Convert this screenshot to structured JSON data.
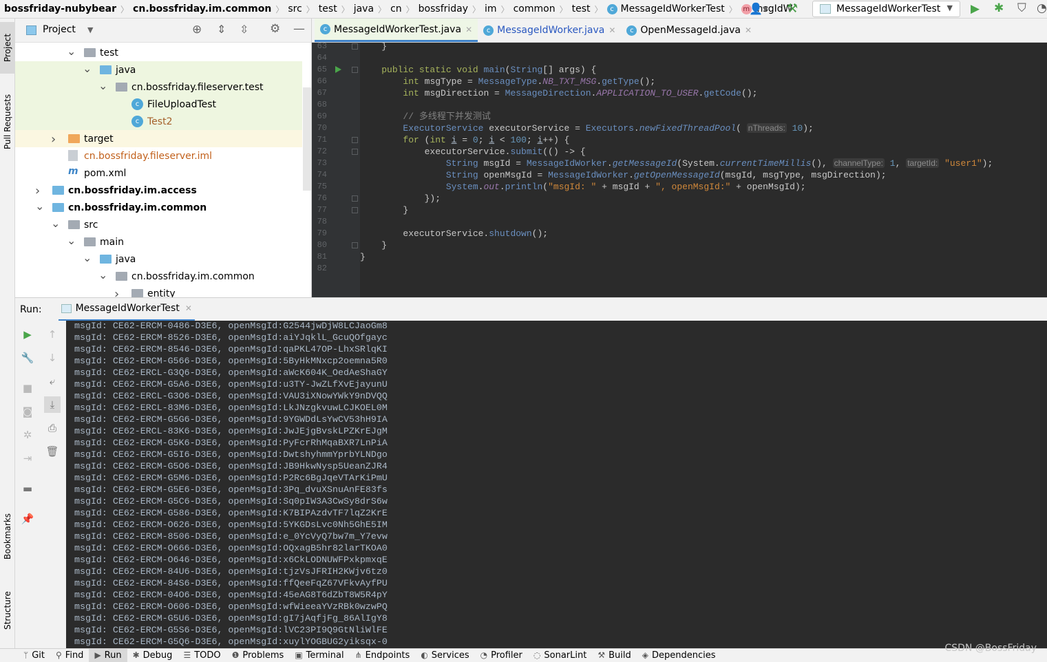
{
  "breadcrumb": [
    "bossfriday-nubybear",
    "cn.bossfriday.im.common",
    "src",
    "test",
    "java",
    "cn",
    "bossfriday",
    "im",
    "common",
    "test",
    "MessageIdWorkerTest",
    "msgIdW"
  ],
  "toolbar": {
    "run_config": "MessageIdWorkerTest"
  },
  "left_strip": {
    "project": "Project",
    "pull_requests": "Pull Requests",
    "bookmarks": "Bookmarks",
    "structure": "Structure"
  },
  "project_panel": {
    "title": "Project",
    "tree": [
      {
        "label": "test",
        "depth": 3,
        "icon": "folder",
        "expanded": true
      },
      {
        "label": "java",
        "depth": 4,
        "icon": "folder-test",
        "expanded": true,
        "highlight": "green"
      },
      {
        "label": "cn.bossfriday.fileserver.test",
        "depth": 5,
        "icon": "package",
        "expanded": true,
        "highlight": "green"
      },
      {
        "label": "FileUploadTest",
        "depth": 6,
        "icon": "class",
        "highlight": "green"
      },
      {
        "label": "Test2",
        "depth": 6,
        "icon": "class",
        "highlight": "green",
        "color": "#a5622c"
      },
      {
        "label": "target",
        "depth": 2,
        "icon": "folder-excluded",
        "expanded": false,
        "highlight": "yellow"
      },
      {
        "label": "cn.bossfriday.fileserver.iml",
        "depth": 2,
        "icon": "file",
        "color": "#c2611c"
      },
      {
        "label": "pom.xml",
        "depth": 2,
        "icon": "maven"
      },
      {
        "label": "cn.bossfriday.im.access",
        "depth": 1,
        "icon": "module",
        "expanded": false,
        "bold": true
      },
      {
        "label": "cn.bossfriday.im.common",
        "depth": 1,
        "icon": "module",
        "expanded": true,
        "bold": true
      },
      {
        "label": "src",
        "depth": 2,
        "icon": "folder",
        "expanded": true
      },
      {
        "label": "main",
        "depth": 3,
        "icon": "folder",
        "expanded": true
      },
      {
        "label": "java",
        "depth": 4,
        "icon": "folder-source",
        "expanded": true
      },
      {
        "label": "cn.bossfriday.im.common",
        "depth": 5,
        "icon": "package",
        "expanded": true
      },
      {
        "label": "entity",
        "depth": 6,
        "icon": "package",
        "expanded": false
      }
    ]
  },
  "editor": {
    "tabs": [
      {
        "label": "MessageIdWorkerTest.java",
        "active": true
      },
      {
        "label": "MessageIdWorker.java",
        "active": false
      },
      {
        "label": "OpenMessageId.java",
        "active": false
      }
    ],
    "lines": [
      {
        "n": "63",
        "fold": true,
        "t": [
          [
            "    }",
            "pl"
          ]
        ]
      },
      {
        "n": "64",
        "t": []
      },
      {
        "n": "65",
        "run": true,
        "fold": true,
        "t": [
          [
            "    ",
            "pl"
          ],
          [
            "public static void ",
            "kw"
          ],
          [
            "main",
            "mth"
          ],
          [
            "(",
            "pl"
          ],
          [
            "String",
            "ty"
          ],
          [
            "[] args) {",
            "pl"
          ]
        ]
      },
      {
        "n": "66",
        "t": [
          [
            "        ",
            "pl"
          ],
          [
            "int ",
            "kw"
          ],
          [
            "msgType = ",
            "pl"
          ],
          [
            "MessageType",
            "ty"
          ],
          [
            ".",
            "pl"
          ],
          [
            "NB_TXT_MSG",
            "cst"
          ],
          [
            ".",
            "pl"
          ],
          [
            "getType",
            "mth"
          ],
          [
            "();",
            "pl"
          ]
        ]
      },
      {
        "n": "67",
        "t": [
          [
            "        ",
            "pl"
          ],
          [
            "int ",
            "kw"
          ],
          [
            "msgDirection = ",
            "pl"
          ],
          [
            "MessageDirection",
            "ty"
          ],
          [
            ".",
            "pl"
          ],
          [
            "APPLICATION_TO_USER",
            "cst"
          ],
          [
            ".",
            "pl"
          ],
          [
            "getCode",
            "mth"
          ],
          [
            "();",
            "pl"
          ]
        ]
      },
      {
        "n": "68",
        "t": []
      },
      {
        "n": "69",
        "t": [
          [
            "        // 多线程下并发测试",
            "cm"
          ]
        ]
      },
      {
        "n": "70",
        "t": [
          [
            "        ",
            "pl"
          ],
          [
            "ExecutorService",
            "ty"
          ],
          [
            " executorService = ",
            "pl"
          ],
          [
            "Executors",
            "ty"
          ],
          [
            ".",
            "pl"
          ],
          [
            "newFixedThreadPool",
            "mi"
          ],
          [
            "( ",
            "pl"
          ],
          [
            "nThreads:",
            "hint"
          ],
          [
            " ",
            "pl"
          ],
          [
            "10",
            "num"
          ],
          [
            ");",
            "pl"
          ]
        ]
      },
      {
        "n": "71",
        "fold": true,
        "t": [
          [
            "        ",
            "pl"
          ],
          [
            "for ",
            "kw"
          ],
          [
            "(",
            "pl"
          ],
          [
            "int ",
            "kw"
          ],
          [
            "i",
            "ul"
          ],
          [
            " = ",
            "pl"
          ],
          [
            "0",
            "num"
          ],
          [
            "; ",
            "pl"
          ],
          [
            "i",
            "ul"
          ],
          [
            " < ",
            "pl"
          ],
          [
            "100",
            "num"
          ],
          [
            "; ",
            "pl"
          ],
          [
            "i",
            "ul"
          ],
          [
            "++) {",
            "pl"
          ]
        ]
      },
      {
        "n": "72",
        "fold": true,
        "t": [
          [
            "            executorService.",
            "pl"
          ],
          [
            "submit",
            "mth"
          ],
          [
            "(() -> {",
            "pl"
          ]
        ]
      },
      {
        "n": "73",
        "t": [
          [
            "                ",
            "pl"
          ],
          [
            "String",
            "ty"
          ],
          [
            " msgId = ",
            "pl"
          ],
          [
            "MessageIdWorker",
            "ty"
          ],
          [
            ".",
            "pl"
          ],
          [
            "getMessageId",
            "mi"
          ],
          [
            "(System.",
            "pl"
          ],
          [
            "currentTimeMillis",
            "mi"
          ],
          [
            "(), ",
            "pl"
          ],
          [
            "channelType:",
            "hint"
          ],
          [
            " ",
            "pl"
          ],
          [
            "1",
            "num"
          ],
          [
            ", ",
            "pl"
          ],
          [
            "targetId:",
            "hint"
          ],
          [
            " ",
            "pl"
          ],
          [
            "\"user1\"",
            "str"
          ],
          [
            ");",
            "pl"
          ]
        ]
      },
      {
        "n": "74",
        "t": [
          [
            "                ",
            "pl"
          ],
          [
            "String",
            "ty"
          ],
          [
            " openMsgId = ",
            "pl"
          ],
          [
            "MessageIdWorker",
            "ty"
          ],
          [
            ".",
            "pl"
          ],
          [
            "getOpenMessageId",
            "mi"
          ],
          [
            "(msgId, msgType, msgDirection);",
            "pl"
          ]
        ]
      },
      {
        "n": "75",
        "t": [
          [
            "                ",
            "pl"
          ],
          [
            "System",
            "ty"
          ],
          [
            ".",
            "pl"
          ],
          [
            "out",
            "fld"
          ],
          [
            ".",
            "pl"
          ],
          [
            "println",
            "mth"
          ],
          [
            "(",
            "pl"
          ],
          [
            "\"msgId: \"",
            "str"
          ],
          [
            " + msgId + ",
            "pl"
          ],
          [
            "\", openMsgId:\"",
            "str"
          ],
          [
            " + openMsgId);",
            "pl"
          ]
        ]
      },
      {
        "n": "76",
        "fold": true,
        "t": [
          [
            "            });",
            "pl"
          ]
        ]
      },
      {
        "n": "77",
        "fold": true,
        "t": [
          [
            "        }",
            "pl"
          ]
        ]
      },
      {
        "n": "78",
        "t": []
      },
      {
        "n": "79",
        "t": [
          [
            "        executorService.",
            "pl"
          ],
          [
            "shutdown",
            "mth"
          ],
          [
            "();",
            "pl"
          ]
        ]
      },
      {
        "n": "80",
        "fold": true,
        "t": [
          [
            "    }",
            "pl"
          ]
        ]
      },
      {
        "n": "81",
        "t": [
          [
            "}",
            "pl"
          ]
        ]
      },
      {
        "n": "82",
        "t": []
      }
    ]
  },
  "run_panel": {
    "label": "Run:",
    "tab": "MessageIdWorkerTest",
    "output": [
      "msgId: CE62-ERCM-0486-D3E6, openMsgId:G2544jwDjW8LCJaoGm8",
      "msgId: CE62-ERCM-8526-D3E6, openMsgId:aiYJqklL_GcuQOfgayc",
      "msgId: CE62-ERCM-8546-D3E6, openMsgId:qaPKL47OP-LhxSRlqKI",
      "msgId: CE62-ERCM-G566-D3E6, openMsgId:5ByHkMNxcp2oemna5R0",
      "msgId: CE62-ERCL-G3Q6-D3E6, openMsgId:aWcK604K_OedAeShaGY",
      "msgId: CE62-ERCM-G5A6-D3E6, openMsgId:u3TY-JwZLfXvEjayunU",
      "msgId: CE62-ERCL-G3O6-D3E6, openMsgId:VAU3iXNowYWkY9nDVQQ",
      "msgId: CE62-ERCL-83M6-D3E6, openMsgId:LkJNzgkvuwLCJKOEL0M",
      "msgId: CE62-ERCM-G5G6-D3E6, openMsgId:9YGWDdLsYwCV53hH9IA",
      "msgId: CE62-ERCL-83K6-D3E6, openMsgId:JwJEjgBvskLPZKrEJgM",
      "msgId: CE62-ERCM-G5K6-D3E6, openMsgId:PyFcrRhMqaBXR7LnPiA",
      "msgId: CE62-ERCM-G5I6-D3E6, openMsgId:DwtshyhmmYprbYLNDgo",
      "msgId: CE62-ERCM-G5O6-D3E6, openMsgId:JB9HkwNysp5UeanZJR4",
      "msgId: CE62-ERCM-G5M6-D3E6, openMsgId:P2Rc6BgJqeVTArKiPmU",
      "msgId: CE62-ERCM-G5E6-D3E6, openMsgId:3Pq_dvuXSnuAnFE83fs",
      "msgId: CE62-ERCM-G5C6-D3E6, openMsgId:Sq0pIW3A3CwSy8drS6w",
      "msgId: CE62-ERCM-G586-D3E6, openMsgId:K7BIPAzdvTF7lqZ2KrE",
      "msgId: CE62-ERCM-O626-D3E6, openMsgId:5YKGDsLvc0Nh5GhE5IM",
      "msgId: CE62-ERCM-8506-D3E6, openMsgId:e_0YcVyQ7bw7m_Y7evw",
      "msgId: CE62-ERCM-O666-D3E6, openMsgId:OQxagB5hr82larTKOA0",
      "msgId: CE62-ERCM-O646-D3E6, openMsgId:x6CkLODNUWFPxkpmxqE",
      "msgId: CE62-ERCM-84U6-D3E6, openMsgId:tjzVsJFRIH2KWjv6tz0",
      "msgId: CE62-ERCM-84S6-D3E6, openMsgId:ffQeeFqZ67VFkvAyfPU",
      "msgId: CE62-ERCM-04O6-D3E6, openMsgId:45eAG8T6dZbT8W5R4pY",
      "msgId: CE62-ERCM-O606-D3E6, openMsgId:wfWieeaYVzRBk0wzwPQ",
      "msgId: CE62-ERCM-G5U6-D3E6, openMsgId:gI7jAqfjFg_86AlIgY8",
      "msgId: CE62-ERCM-G5S6-D3E6, openMsgId:lVC23PI9Q9GtNliWlFE",
      "msgId: CE62-ERCM-G5Q6-D3E6, openMsgId:xuylYOGBUG2yiksqx-0"
    ]
  },
  "statusbar": [
    {
      "label": "Git",
      "icon": "git-branch-icon",
      "glyph": "ᛘ"
    },
    {
      "label": "Find",
      "icon": "search-icon",
      "glyph": "⚲"
    },
    {
      "label": "Run",
      "icon": "run-icon",
      "glyph": "▶",
      "active": true
    },
    {
      "label": "Debug",
      "icon": "bug-icon",
      "glyph": "✱"
    },
    {
      "label": "TODO",
      "icon": "list-icon",
      "glyph": "☰"
    },
    {
      "label": "Problems",
      "icon": "problems-icon",
      "glyph": "❶"
    },
    {
      "label": "Terminal",
      "icon": "terminal-icon",
      "glyph": "▣"
    },
    {
      "label": "Endpoints",
      "icon": "endpoints-icon",
      "glyph": "⋔"
    },
    {
      "label": "Services",
      "icon": "services-icon",
      "glyph": "◐"
    },
    {
      "label": "Profiler",
      "icon": "profiler-icon",
      "glyph": "◔"
    },
    {
      "label": "SonarLint",
      "icon": "sonarlint-icon",
      "glyph": "◌"
    },
    {
      "label": "Build",
      "icon": "hammer-icon",
      "glyph": "⚒"
    },
    {
      "label": "Dependencies",
      "icon": "dependencies-icon",
      "glyph": "◈"
    }
  ],
  "watermark": "CSDN @BossFriday"
}
